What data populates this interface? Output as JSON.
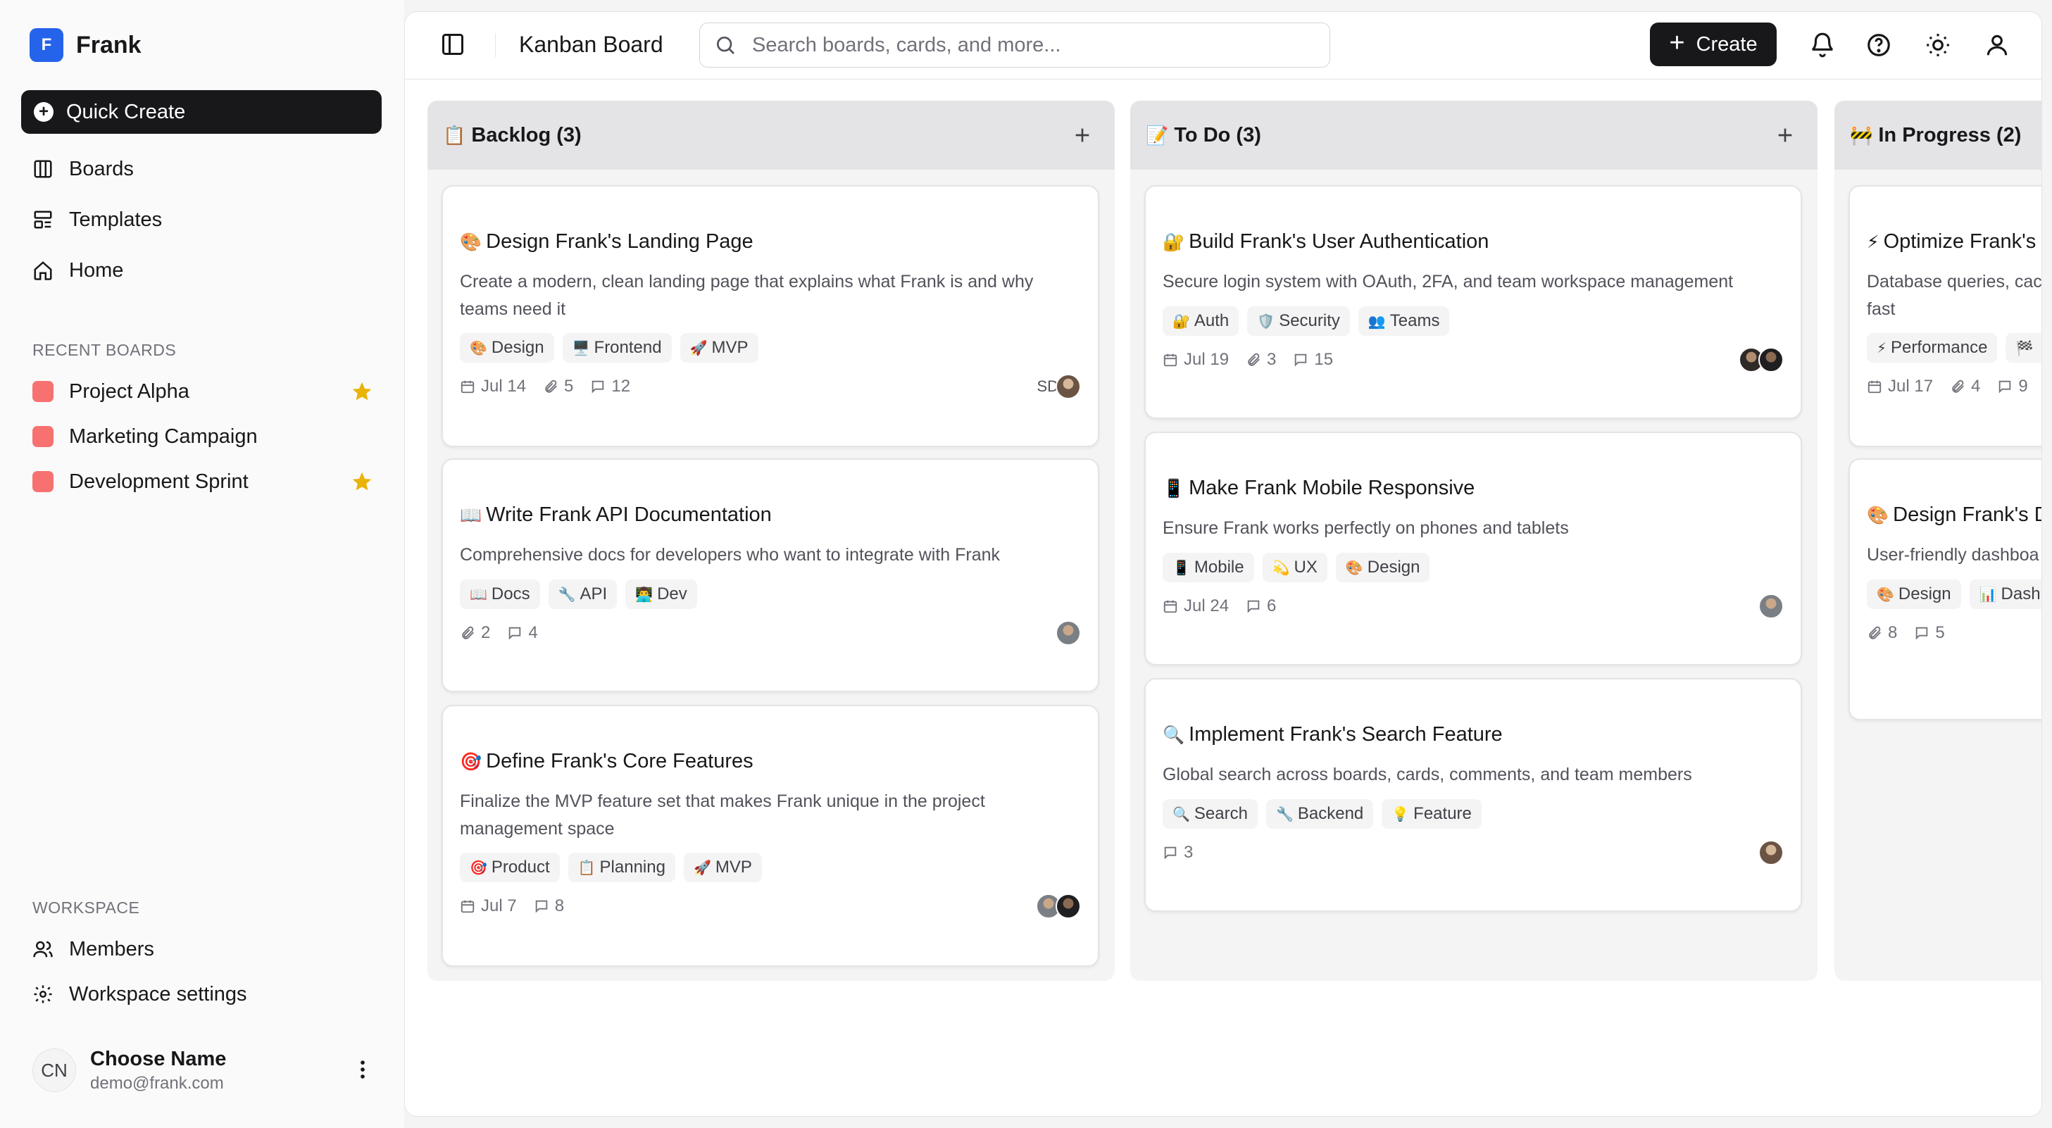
{
  "brand": {
    "logo_letter": "F",
    "name": "Frank"
  },
  "sidebar": {
    "quick_create": "Quick Create",
    "nav": [
      {
        "label": "Boards",
        "icon": "columns-icon"
      },
      {
        "label": "Templates",
        "icon": "template-icon"
      },
      {
        "label": "Home",
        "icon": "home-icon"
      }
    ],
    "recent_label": "RECENT BOARDS",
    "recent": [
      {
        "label": "Project Alpha",
        "color": "#f87171",
        "starred": true
      },
      {
        "label": "Marketing Campaign",
        "color": "#f87171",
        "starred": false
      },
      {
        "label": "Development Sprint",
        "color": "#f87171",
        "starred": true
      }
    ],
    "workspace_label": "WORKSPACE",
    "workspace": [
      {
        "label": "Members",
        "icon": "users-icon"
      },
      {
        "label": "Workspace settings",
        "icon": "gear-icon"
      }
    ],
    "user": {
      "initials": "CN",
      "name": "Choose Name",
      "email": "demo@frank.com"
    }
  },
  "header": {
    "title": "Kanban Board",
    "search_placeholder": "Search boards, cards, and more...",
    "create_label": "Create"
  },
  "columns": [
    {
      "icon": "📋",
      "title": "Backlog (3)",
      "cards": [
        {
          "icon": "🎨",
          "title": "Design Frank's Landing Page",
          "desc": "Create a modern, clean landing page that explains what Frank is and why teams need it",
          "tags": [
            {
              "icon": "🎨",
              "label": "Design"
            },
            {
              "icon": "🖥️",
              "label": "Frontend"
            },
            {
              "icon": "🚀",
              "label": "MVP"
            }
          ],
          "date": "Jul 14",
          "attachments": "5",
          "comments": "12",
          "avatar_text": "SD"
        },
        {
          "icon": "📖",
          "title": "Write Frank API Documentation",
          "desc": "Comprehensive docs for developers who want to integrate with Frank",
          "tags": [
            {
              "icon": "📖",
              "label": "Docs"
            },
            {
              "icon": "🔧",
              "label": "API"
            },
            {
              "icon": "👨‍💻",
              "label": "Dev"
            }
          ],
          "attachments": "2",
          "comments": "4"
        },
        {
          "icon": "🎯",
          "title": "Define Frank's Core Features",
          "desc": "Finalize the MVP feature set that makes Frank unique in the project management space",
          "tags": [
            {
              "icon": "🎯",
              "label": "Product"
            },
            {
              "icon": "📋",
              "label": "Planning"
            },
            {
              "icon": "🚀",
              "label": "MVP"
            }
          ],
          "date": "Jul 7",
          "comments": "8"
        }
      ]
    },
    {
      "icon": "📝",
      "title": "To Do (3)",
      "cards": [
        {
          "icon": "🔐",
          "title": "Build Frank's User Authentication",
          "desc": "Secure login system with OAuth, 2FA, and team workspace management",
          "tags": [
            {
              "icon": "🔐",
              "label": "Auth"
            },
            {
              "icon": "🛡️",
              "label": "Security"
            },
            {
              "icon": "👥",
              "label": "Teams"
            }
          ],
          "date": "Jul 19",
          "attachments": "3",
          "comments": "15"
        },
        {
          "icon": "📱",
          "title": "Make Frank Mobile Responsive",
          "desc": "Ensure Frank works perfectly on phones and tablets",
          "tags": [
            {
              "icon": "📱",
              "label": "Mobile"
            },
            {
              "icon": "💫",
              "label": "UX"
            },
            {
              "icon": "🎨",
              "label": "Design"
            }
          ],
          "date": "Jul 24",
          "comments": "6"
        },
        {
          "icon": "🔍",
          "title": "Implement Frank's Search Feature",
          "desc": "Global search across boards, cards, comments, and team members",
          "tags": [
            {
              "icon": "🔍",
              "label": "Search"
            },
            {
              "icon": "🔧",
              "label": "Backend"
            },
            {
              "icon": "💡",
              "label": "Feature"
            }
          ],
          "comments": "3"
        }
      ]
    },
    {
      "icon": "🚧",
      "title": "In Progress (2)",
      "cards": [
        {
          "icon": "⚡",
          "title": "Optimize Frank's",
          "desc": "Database queries, cac fast",
          "tags": [
            {
              "icon": "⚡",
              "label": "Performance"
            },
            {
              "icon": "🏁",
              "label": ""
            }
          ],
          "date": "Jul 17",
          "attachments": "4",
          "comments": "9"
        },
        {
          "icon": "🎨",
          "title": "Design Frank's D",
          "desc": "User-friendly dashboa",
          "tags": [
            {
              "icon": "🎨",
              "label": "Design"
            },
            {
              "icon": "📊",
              "label": "Dash"
            }
          ],
          "attachments": "8",
          "comments": "5"
        }
      ]
    }
  ]
}
